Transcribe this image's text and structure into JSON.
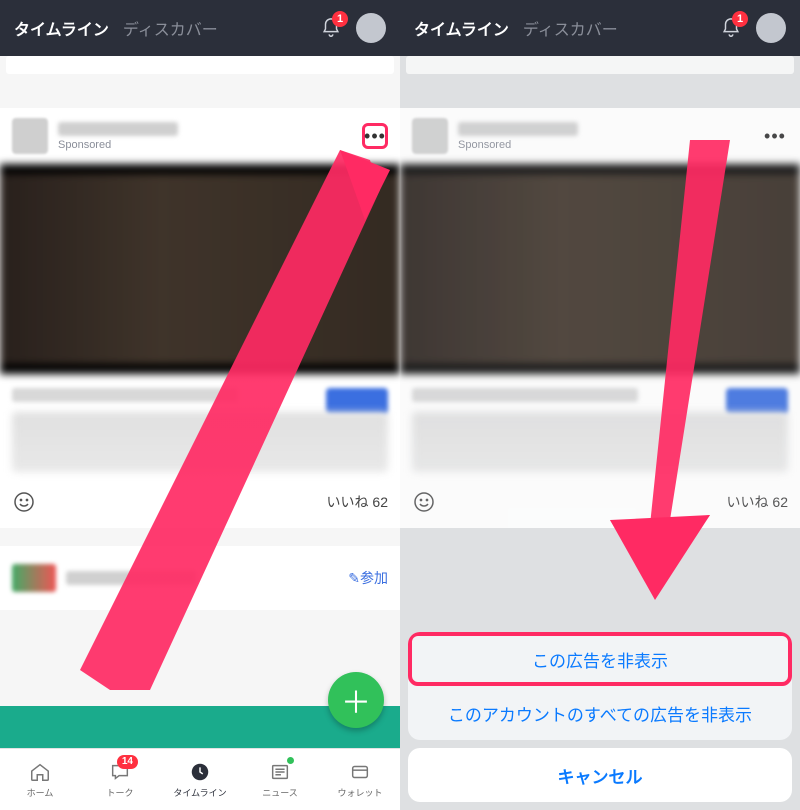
{
  "header": {
    "tab_timeline": "タイムライン",
    "tab_discover": "ディスカバー",
    "notif_count": "1"
  },
  "post": {
    "sponsored": "Sponsored",
    "likes_label": "いいね 62"
  },
  "next": {
    "join": "参加"
  },
  "tabbar": {
    "home": "ホーム",
    "talk": "トーク",
    "talk_badge": "14",
    "timeline": "タイムライン",
    "news": "ニュース",
    "wallet": "ウォレット"
  },
  "sheet": {
    "hide_ad": "この広告を非表示",
    "hide_all": "このアカウントのすべての広告を非表示",
    "cancel": "キャンセル"
  }
}
